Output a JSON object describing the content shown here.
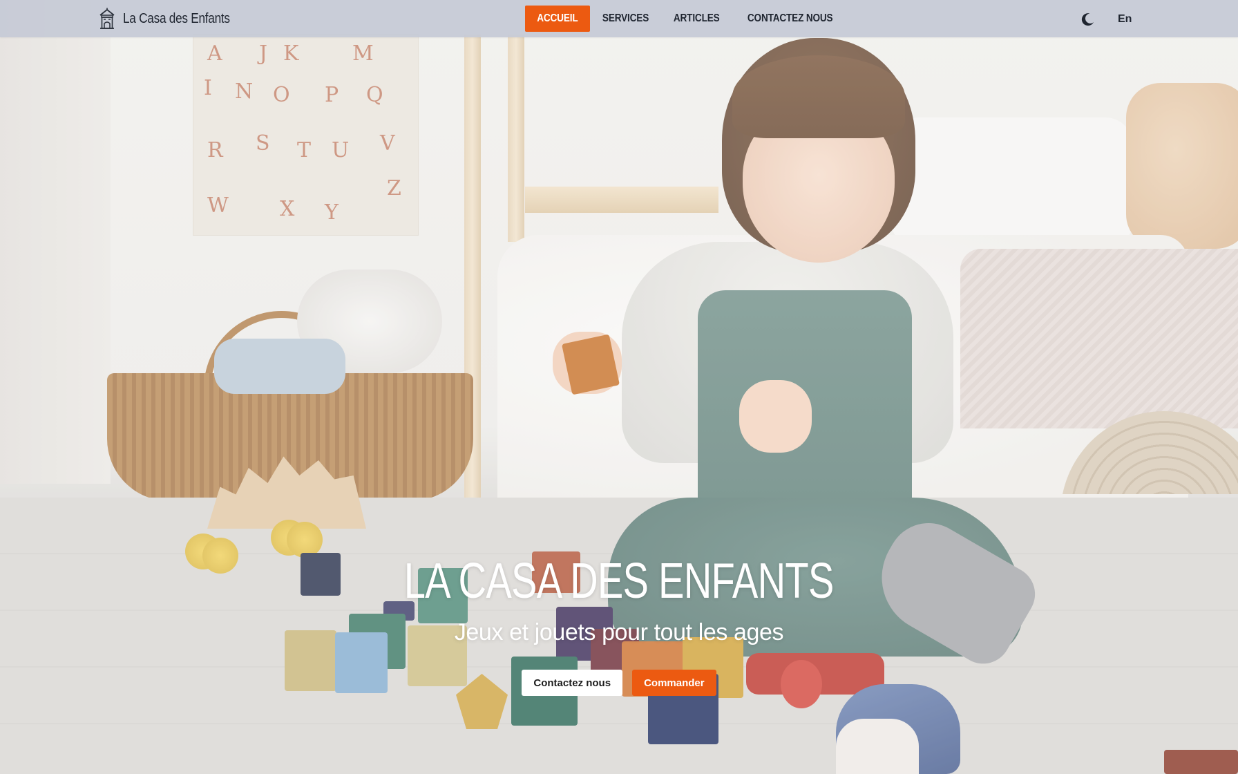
{
  "brand": {
    "name": "La Casa des Enfants",
    "icon": "house-icon"
  },
  "nav": {
    "items": [
      {
        "label": "ACCUEIL",
        "active": true
      },
      {
        "label": "SERVICES",
        "active": false
      },
      {
        "label": "ARTICLES",
        "active": false
      },
      {
        "label": "CONTACTEZ NOUS",
        "active": false
      }
    ],
    "theme_icon": "moon-icon",
    "language": "En"
  },
  "hero": {
    "title": "LA CASA DES ENFANTS",
    "subtitle": "Jeux et jouets pour tout les ages",
    "buttons": {
      "contact": "Contactez nous",
      "order": "Commander"
    },
    "background_image": "child playing with wooden blocks in a bedroom"
  },
  "colors": {
    "accent": "#ec5a11",
    "navbar": "#c6cad6",
    "text_dark": "#1f2530"
  }
}
